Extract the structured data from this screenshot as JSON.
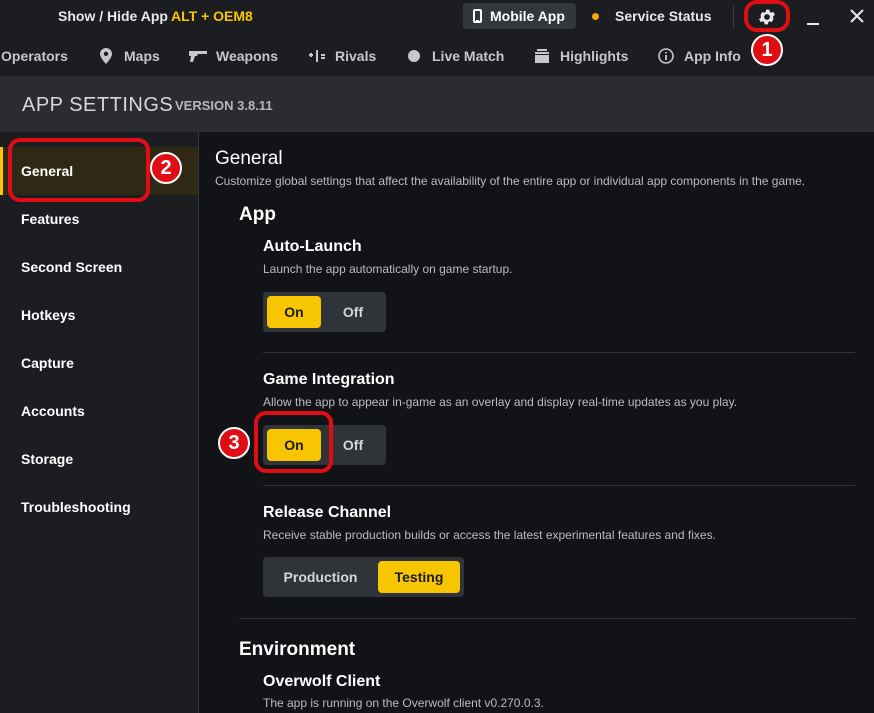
{
  "topbar": {
    "hotkey_label": "Show / Hide App",
    "hotkey_value": "ALT + OEM8",
    "mobile_app_label": "Mobile App",
    "service_status_label": "Service Status",
    "service_status_color": "#f7a600"
  },
  "nav": {
    "items": [
      {
        "label": "Operators",
        "icon": "none"
      },
      {
        "label": "Maps",
        "icon": "map-pin-icon"
      },
      {
        "label": "Weapons",
        "icon": "gun-icon"
      },
      {
        "label": "Rivals",
        "icon": "versus-icon"
      },
      {
        "label": "Live Match",
        "icon": "live-dot-icon"
      },
      {
        "label": "Highlights",
        "icon": "film-icon"
      },
      {
        "label": "App Info",
        "icon": "info-icon"
      }
    ]
  },
  "header": {
    "title": "APP SETTINGS",
    "version": "VERSION 3.8.11"
  },
  "sidebar": {
    "items": [
      {
        "label": "General",
        "active": true
      },
      {
        "label": "Features"
      },
      {
        "label": "Second Screen"
      },
      {
        "label": "Hotkeys"
      },
      {
        "label": "Capture"
      },
      {
        "label": "Accounts"
      },
      {
        "label": "Storage"
      },
      {
        "label": "Troubleshooting"
      }
    ]
  },
  "main": {
    "title": "General",
    "description": "Customize global settings that affect the availability of the entire app or individual app components in the game.",
    "app_group": {
      "title": "App",
      "settings": [
        {
          "title": "Auto-Launch",
          "description": "Launch the app automatically on game startup.",
          "options": [
            "On",
            "Off"
          ],
          "selected": "On"
        },
        {
          "title": "Game Integration",
          "description": "Allow the app to appear in-game as an overlay and display real-time updates as you play.",
          "options": [
            "On",
            "Off"
          ],
          "selected": "On"
        },
        {
          "title": "Release Channel",
          "description": "Receive stable production builds or access the latest experimental features and fixes.",
          "options": [
            "Production",
            "Testing"
          ],
          "selected": "Testing"
        }
      ]
    },
    "environment_group": {
      "title": "Environment",
      "settings": [
        {
          "title": "Overwolf Client",
          "description": "The app is running on the Overwolf client v0.270.0.3."
        }
      ]
    }
  },
  "annotations": {
    "badges": [
      "1",
      "2",
      "3"
    ]
  },
  "colors": {
    "accent": "#f7c600",
    "highlight": "#e10d15"
  }
}
